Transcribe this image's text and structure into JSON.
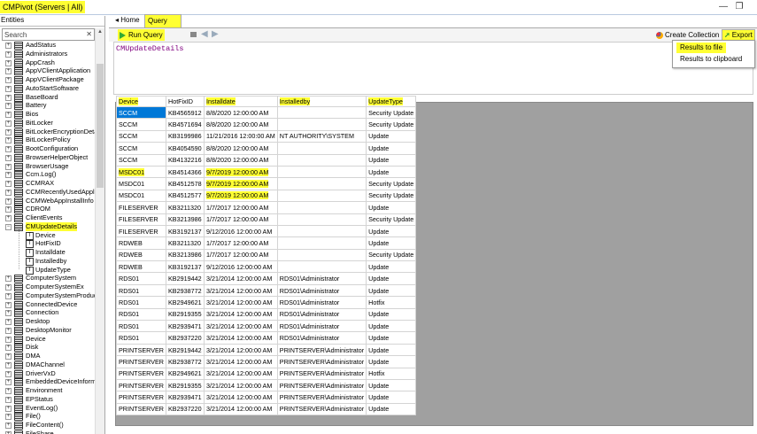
{
  "window": {
    "title": "CMPivot (Servers | All)",
    "restore_glyph": "❐"
  },
  "left_panel": {
    "label": "Entities",
    "search": {
      "placeholder": "Search",
      "clear_glyph": "✕"
    },
    "entities": [
      "AadStatus",
      "Administrators",
      "AppCrash",
      "AppVClientApplication",
      "AppVClientPackage",
      "AutoStartSoftware",
      "BaseBoard",
      "Battery",
      "Bios",
      "BitLocker",
      "BitLockerEncryptionDetails",
      "BitLockerPolicy",
      "BootConfiguration",
      "BrowserHelperObject",
      "BrowserUsage",
      "Ccm.Log()",
      "CCMRAX",
      "CCMRecentlyUsedApplica",
      "CCMWebAppInstallInfo",
      "CDROM",
      "ClientEvents",
      "CMUpdateDetails"
    ],
    "expanded_children": [
      {
        "label": "Device",
        "icon": "T"
      },
      {
        "label": "HotFixID",
        "icon": "T"
      },
      {
        "label": "Installdate",
        "icon": "T"
      },
      {
        "label": "Installedby",
        "icon": "T"
      },
      {
        "label": "UpdateType",
        "icon": "T"
      }
    ],
    "entities_after": [
      "ComputerSystem",
      "ComputerSystemEx",
      "ComputerSystemProduct",
      "ConnectedDevice",
      "Connection",
      "Desktop",
      "DesktopMonitor",
      "Device",
      "Disk",
      "DMA",
      "DMAChannel",
      "DriverVxD",
      "EmbeddedDeviceInformati",
      "Environment",
      "EPStatus",
      "EventLog()",
      "File()",
      "FileContent()",
      "FileShare"
    ]
  },
  "tabs": {
    "home": "Home",
    "query": "Query"
  },
  "toolbar": {
    "run_query": "Run Query",
    "create_collection": "Create Collection",
    "export": "Export",
    "back_glyph": "◀",
    "forward_glyph": "▶"
  },
  "export_menu": {
    "results_to_file": "Results to file",
    "results_to_clipboard": "Results to clipboard"
  },
  "editor": {
    "query": "CMUpdateDetails",
    "splitter_glyph": "^"
  },
  "grid": {
    "columns": [
      "Device",
      "HotFixID",
      "Installdate",
      "Installedby",
      "UpdateType"
    ],
    "rows": [
      [
        "SCCM",
        "KB4565912",
        "8/8/2020 12:00:00 AM",
        "",
        "Security Update"
      ],
      [
        "SCCM",
        "KB4571694",
        "8/8/2020 12:00:00 AM",
        "",
        "Security Update"
      ],
      [
        "SCCM",
        "KB3199986",
        "11/21/2016 12:00:00 AM",
        "NT AUTHORITY\\SYSTEM",
        "Update"
      ],
      [
        "SCCM",
        "KB4054590",
        "8/8/2020 12:00:00 AM",
        "",
        "Update"
      ],
      [
        "SCCM",
        "KB4132216",
        "8/8/2020 12:00:00 AM",
        "",
        "Update"
      ],
      [
        "MSDC01",
        "KB4514366",
        "9/7/2019 12:00:00 AM",
        "",
        "Update"
      ],
      [
        "MSDC01",
        "KB4512578",
        "9/7/2019 12:00:00 AM",
        "",
        "Security Update"
      ],
      [
        "MSDC01",
        "KB4512577",
        "9/7/2019 12:00:00 AM",
        "",
        "Security Update"
      ],
      [
        "FILESERVER",
        "KB3211320",
        "1/7/2017 12:00:00 AM",
        "",
        "Update"
      ],
      [
        "FILESERVER",
        "KB3213986",
        "1/7/2017 12:00:00 AM",
        "",
        "Security Update"
      ],
      [
        "FILESERVER",
        "KB3192137",
        "9/12/2016 12:00:00 AM",
        "",
        "Update"
      ],
      [
        "RDWEB",
        "KB3211320",
        "1/7/2017 12:00:00 AM",
        "",
        "Update"
      ],
      [
        "RDWEB",
        "KB3213986",
        "1/7/2017 12:00:00 AM",
        "",
        "Security Update"
      ],
      [
        "RDWEB",
        "KB3192137",
        "9/12/2016 12:00:00 AM",
        "",
        "Update"
      ],
      [
        "RDS01",
        "KB2919442",
        "3/21/2014 12:00:00 AM",
        "RDS01\\Administrator",
        "Update"
      ],
      [
        "RDS01",
        "KB2938772",
        "3/21/2014 12:00:00 AM",
        "RDS01\\Administrator",
        "Update"
      ],
      [
        "RDS01",
        "KB2949621",
        "3/21/2014 12:00:00 AM",
        "RDS01\\Administrator",
        "Hotfix"
      ],
      [
        "RDS01",
        "KB2919355",
        "3/21/2014 12:00:00 AM",
        "RDS01\\Administrator",
        "Update"
      ],
      [
        "RDS01",
        "KB2939471",
        "3/21/2014 12:00:00 AM",
        "RDS01\\Administrator",
        "Update"
      ],
      [
        "RDS01",
        "KB2937220",
        "3/21/2014 12:00:00 AM",
        "RDS01\\Administrator",
        "Update"
      ],
      [
        "PRINTSERVER",
        "KB2919442",
        "3/21/2014 12:00:00 AM",
        "PRINTSERVER\\Administrator",
        "Update"
      ],
      [
        "PRINTSERVER",
        "KB2938772",
        "3/21/2014 12:00:00 AM",
        "PRINTSERVER\\Administrator",
        "Update"
      ],
      [
        "PRINTSERVER",
        "KB2949621",
        "3/21/2014 12:00:00 AM",
        "PRINTSERVER\\Administrator",
        "Hotfix"
      ],
      [
        "PRINTSERVER",
        "KB2919355",
        "3/21/2014 12:00:00 AM",
        "PRINTSERVER\\Administrator",
        "Update"
      ],
      [
        "PRINTSERVER",
        "KB2939471",
        "3/21/2014 12:00:00 AM",
        "PRINTSERVER\\Administrator",
        "Update"
      ],
      [
        "PRINTSERVER",
        "KB2937220",
        "3/21/2014 12:00:00 AM",
        "PRINTSERVER\\Administrator",
        "Update"
      ]
    ]
  },
  "colors": {
    "highlight": "#ffff33",
    "selection": "#0078d7",
    "query_text": "#800080",
    "results_bg": "#a0a0a0"
  }
}
